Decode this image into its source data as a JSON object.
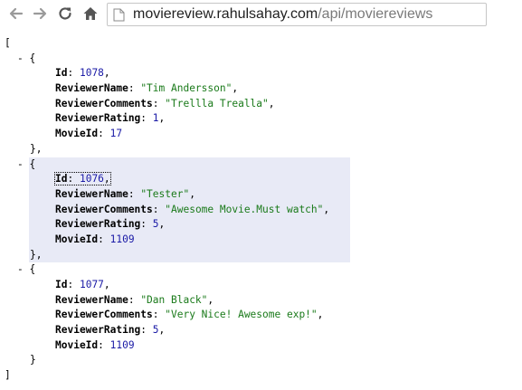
{
  "browser": {
    "url_host": "moviereview.rahulsahay.com",
    "url_path": "/api/moviereviews",
    "icons": [
      "back-arrow-icon",
      "forward-arrow-icon",
      "reload-icon",
      "home-icon",
      "page-icon"
    ]
  },
  "json_view": {
    "open_bracket": "[",
    "close_bracket": "]",
    "toggle_symbol": "-",
    "open_brace": "{",
    "close_brace_comma": "},",
    "close_brace": "}",
    "keys": {
      "id": "Id",
      "reviewer_name": "ReviewerName",
      "reviewer_comments": "ReviewerComments",
      "reviewer_rating": "ReviewerRating",
      "movie_id": "MovieId"
    },
    "colors": {
      "number": "#1a1aa6",
      "string": "#1a7a1a",
      "selection": "#e8eaf6"
    },
    "items": [
      {
        "id": "1078",
        "reviewer_name": "\"Tim Andersson\"",
        "reviewer_comments": "\"Trellla Trealla\"",
        "reviewer_rating": "1",
        "movie_id": "17"
      },
      {
        "id": "1076",
        "reviewer_name": "\"Tester\"",
        "reviewer_comments": "\"Awesome Movie.Must watch\"",
        "reviewer_rating": "5",
        "movie_id": "1109"
      },
      {
        "id": "1077",
        "reviewer_name": "\"Dan Black\"",
        "reviewer_comments": "\"Very Nice! Awesome exp!\"",
        "reviewer_rating": "5",
        "movie_id": "1109"
      }
    ]
  }
}
